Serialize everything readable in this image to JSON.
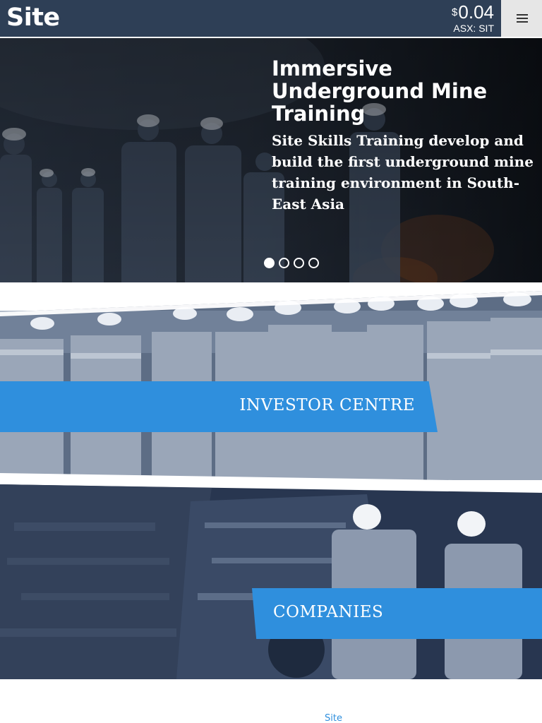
{
  "header": {
    "logo_text": "Site",
    "price_currency": "$",
    "price_value": "0.04",
    "ticker": "ASX: SIT",
    "menu_icon": "hamburger-menu-icon"
  },
  "hero": {
    "title": "Immersive Underground Mine Training",
    "text": "Site Skills Training develop and build the first underground mine training environment in South-East Asia",
    "slide_count": 4,
    "active_slide": 1
  },
  "panels": {
    "investor_label": "INVESTOR CENTRE",
    "companies_label": "COMPANIES"
  },
  "footer": {
    "link_text": "Site"
  },
  "colors": {
    "header_bg": "#2e3f56",
    "accent_blue": "#2f8fdd",
    "menu_bg": "#e6e6e6"
  }
}
